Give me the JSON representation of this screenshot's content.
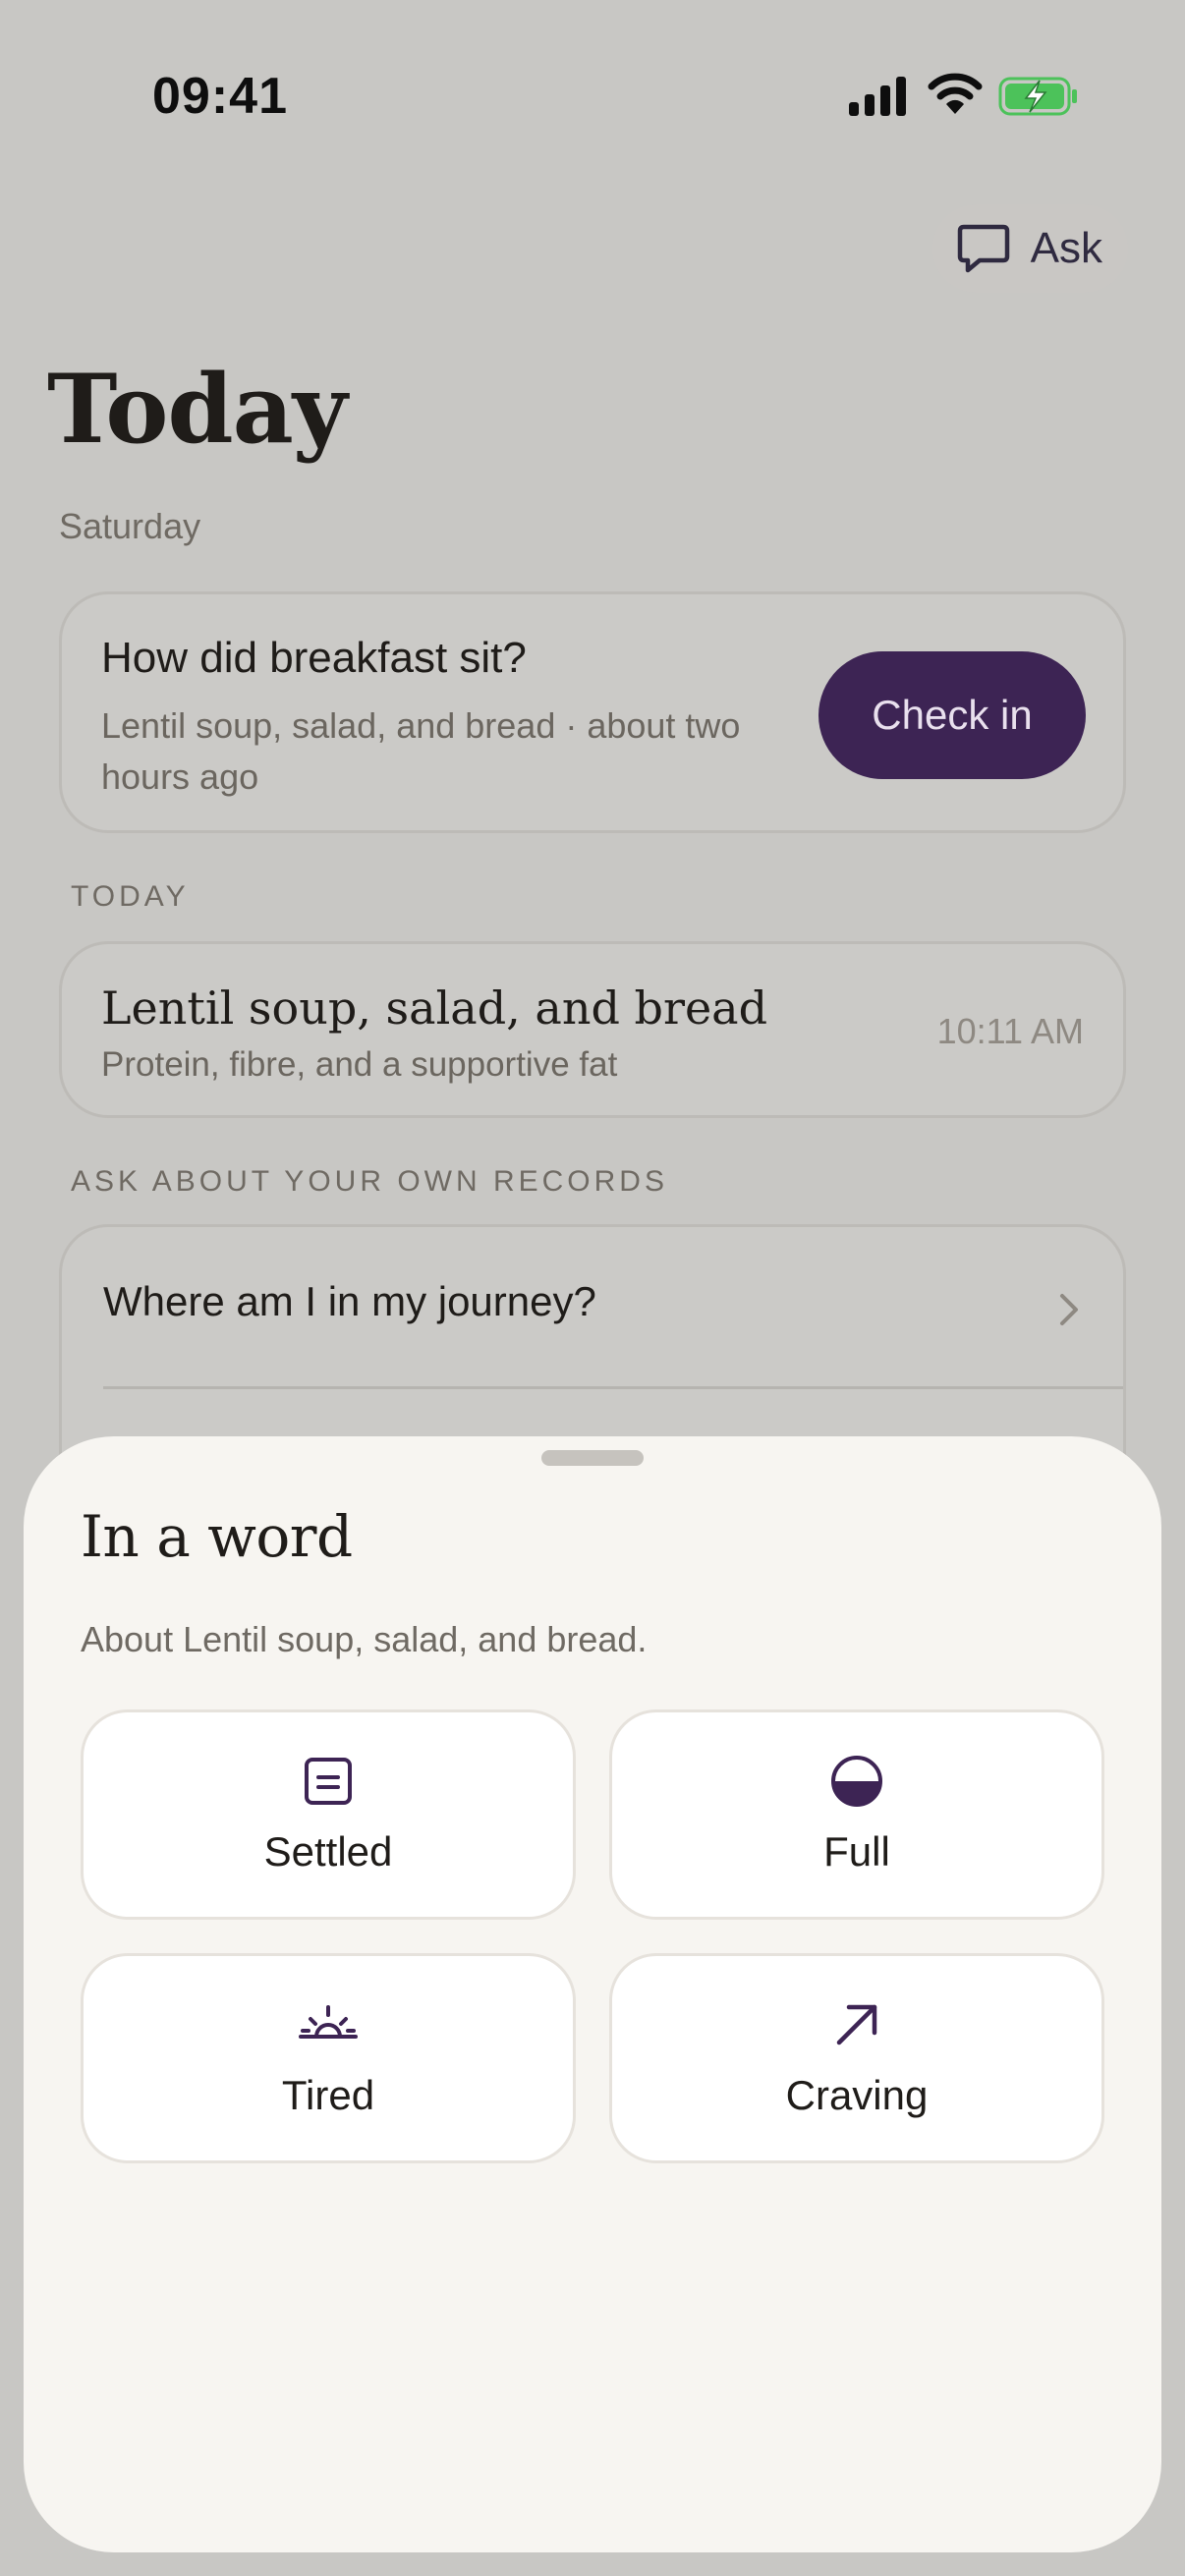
{
  "status": {
    "time": "09:41"
  },
  "header": {
    "ask_label": "Ask"
  },
  "page": {
    "title": "Today",
    "subtitle": "Saturday"
  },
  "checkin": {
    "title": "How did breakfast sit?",
    "description": "Lentil soup, salad, and bread · about two hours ago",
    "button_label": "Check in"
  },
  "today_section": {
    "label": "TODAY",
    "meal": {
      "title": "Lentil soup, salad, and bread",
      "description": "Protein, fibre, and a supportive fat",
      "time": "10:11 AM"
    }
  },
  "records_section": {
    "label": "ASK ABOUT YOUR OWN RECORDS",
    "items": [
      {
        "label": "Where am I in my journey?"
      }
    ]
  },
  "sheet": {
    "title": "In a word",
    "subtitle": "About Lentil soup, salad, and bread.",
    "options": [
      {
        "label": "Settled",
        "icon": "note-icon"
      },
      {
        "label": "Full",
        "icon": "half-circle-icon"
      },
      {
        "label": "Tired",
        "icon": "sunset-icon"
      },
      {
        "label": "Craving",
        "icon": "arrow-up-right-icon"
      }
    ]
  },
  "colors": {
    "accent": "#3d2454",
    "sheet_bg": "#f7f5f1",
    "battery": "#4cc25a"
  }
}
